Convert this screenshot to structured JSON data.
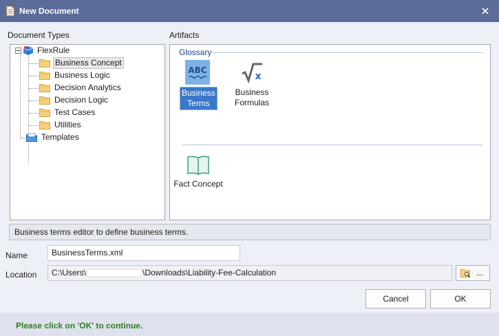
{
  "window": {
    "title": "New Document",
    "icon": "document-icon",
    "close_icon": "close-icon"
  },
  "document_types": {
    "label": "Document Types",
    "root": {
      "label": "FlexRule",
      "expander": "⊟",
      "icon": "cube-icon"
    },
    "children": [
      {
        "label": "Business Concept",
        "selected": true
      },
      {
        "label": "Business Logic"
      },
      {
        "label": "Decision Analytics"
      },
      {
        "label": "Decision Logic"
      },
      {
        "label": "Test Cases"
      },
      {
        "label": "Utilities"
      }
    ],
    "templates": {
      "label": "Templates",
      "icon": "templates-icon"
    }
  },
  "artifacts": {
    "label": "Artifacts",
    "group": "Glossary",
    "items": [
      {
        "line1": "Business",
        "line2": "Terms",
        "icon": "abc-icon",
        "selected": true
      },
      {
        "line1": "Business",
        "line2": "Formulas",
        "icon": "formula-icon"
      },
      {
        "line1": "Fact Concept",
        "line2": "",
        "icon": "book-icon"
      }
    ]
  },
  "description": "Business terms editor to define business terms.",
  "name": {
    "label": "Name",
    "value": "BusinessTerms.xml"
  },
  "location": {
    "label": "Location",
    "prefix": "C:\\Users\\",
    "suffix": "\\Downloads\\Liability-Fee-Calculation",
    "browse_label": "...",
    "browse_icon": "folder-search-icon"
  },
  "buttons": {
    "cancel": "Cancel",
    "ok": "OK"
  },
  "footer": {
    "message": "Please click on 'OK' to continue.",
    "color": "#2d7d1e"
  },
  "colors": {
    "titlebar": "#5b6c99",
    "selection": "#3a79c7",
    "group_label": "#1f3f8f"
  }
}
